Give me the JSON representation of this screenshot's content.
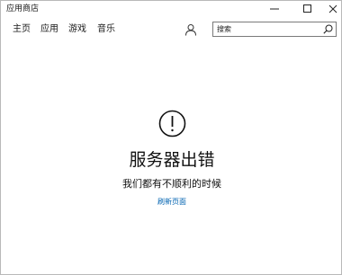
{
  "window": {
    "title": "应用商店"
  },
  "nav": {
    "items": [
      {
        "label": "主页"
      },
      {
        "label": "应用"
      },
      {
        "label": "游戏"
      },
      {
        "label": "音乐"
      }
    ]
  },
  "search": {
    "placeholder": "搜索"
  },
  "error": {
    "title": "服务器出错",
    "message": "我们都有不顺利的时候",
    "refresh_label": "刷新页面"
  },
  "colors": {
    "link": "#0063b1",
    "text": "#111111",
    "background": "#ffffff"
  },
  "icons": {
    "minimize": "minimize-icon",
    "maximize": "maximize-icon",
    "close": "close-icon",
    "account": "account-icon",
    "search": "search-icon",
    "error": "exclamation-circle-icon"
  }
}
